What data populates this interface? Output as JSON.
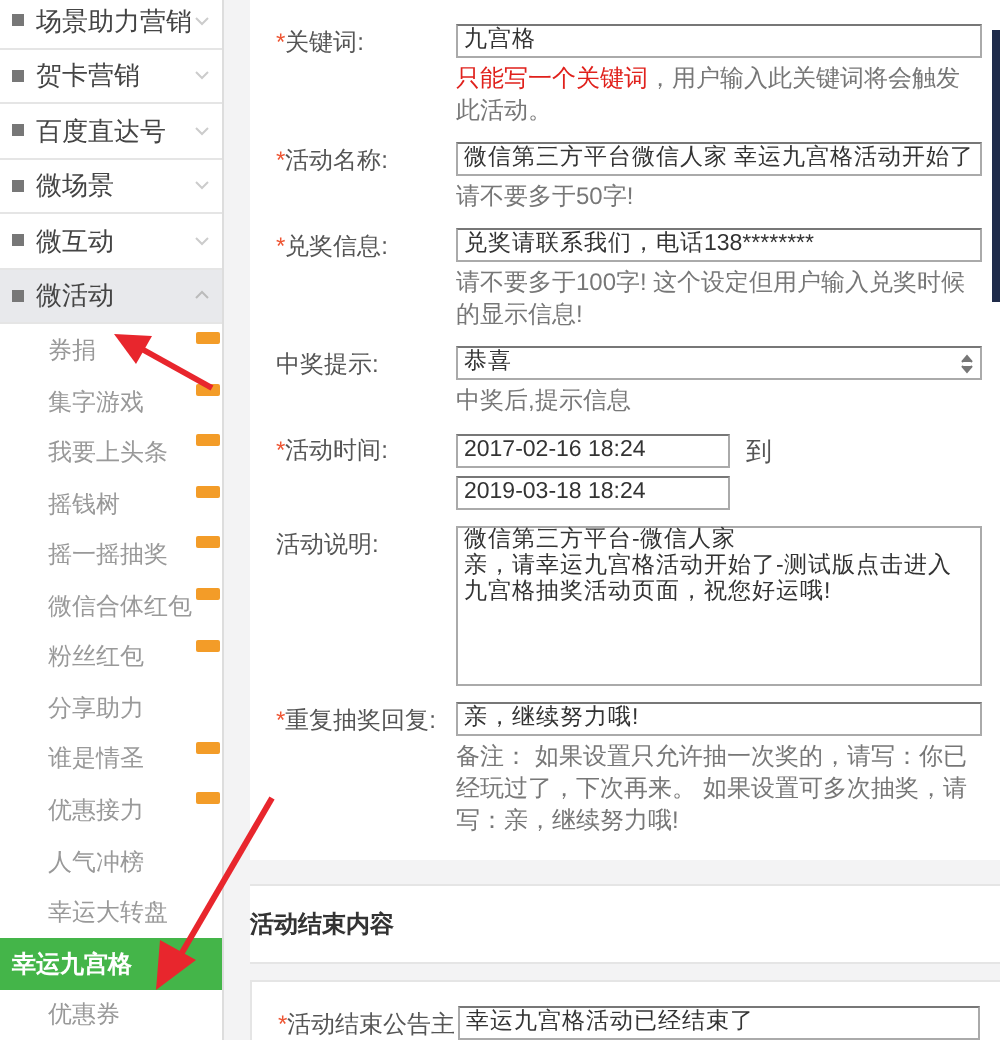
{
  "sidebar": {
    "menus": [
      {
        "label": "场景助力营销",
        "expanded": false
      },
      {
        "label": "贺卡营销",
        "expanded": false
      },
      {
        "label": "百度直达号",
        "expanded": false
      },
      {
        "label": "微场景",
        "expanded": false
      },
      {
        "label": "微互动",
        "expanded": false
      },
      {
        "label": "微活动",
        "expanded": true,
        "children": [
          {
            "label": "券捐",
            "badge": true,
            "selected": false
          },
          {
            "label": "集字游戏",
            "badge": true,
            "selected": false
          },
          {
            "label": "我要上头条",
            "badge": true,
            "selected": false
          },
          {
            "label": "摇钱树",
            "badge": true,
            "selected": false
          },
          {
            "label": "摇一摇抽奖",
            "badge": true,
            "selected": false
          },
          {
            "label": "微信合体红包",
            "badge": true,
            "selected": false
          },
          {
            "label": "粉丝红包",
            "badge": true,
            "selected": false
          },
          {
            "label": "分享助力",
            "badge": false,
            "selected": false
          },
          {
            "label": "谁是情圣",
            "badge": true,
            "selected": false
          },
          {
            "label": "优惠接力",
            "badge": true,
            "selected": false
          },
          {
            "label": "人气冲榜",
            "badge": false,
            "selected": false
          },
          {
            "label": "幸运大转盘",
            "badge": false,
            "selected": false
          },
          {
            "label": "幸运九宫格",
            "badge": false,
            "selected": true
          },
          {
            "label": "优惠券",
            "badge": false,
            "selected": false
          }
        ]
      }
    ]
  },
  "form": {
    "fields": [
      {
        "kind": "text",
        "label": "关键词:",
        "required_mark": "*",
        "value": "九宫格",
        "hint_warning": "只能写一个关键词",
        "hint": "，用户输入此关键词将会触发此活动。"
      },
      {
        "kind": "text",
        "label": "活动名称:",
        "required_mark": "*",
        "value": "微信第三方平台微信人家 幸运九宫格活动开始了",
        "hint": "请不要多于50字!"
      },
      {
        "kind": "text",
        "label": "兑奖信息:",
        "required_mark": "*",
        "value": "兑奖请联系我们，电话138********",
        "hint": "请不要多于100字! 这个设定但用户输入兑奖时候的显示信息!"
      },
      {
        "kind": "select",
        "label": "中奖提示:",
        "value": "恭喜",
        "hint": "中奖后,提示信息"
      },
      {
        "kind": "daterange",
        "label": "活动时间:",
        "required_mark": "*",
        "start": "2017-02-16 18:24",
        "separator": "到",
        "end": "2019-03-18 18:24"
      },
      {
        "kind": "textarea",
        "label": "活动说明:",
        "lines": [
          "微信第三方平台-微信人家",
          "亲，请幸运九宫格活动开始了-测试版点击进入",
          "九宫格抽奖活动页面，祝您好运哦!"
        ]
      },
      {
        "kind": "text",
        "label": "重复抽奖回复:",
        "required_mark": "*",
        "value": "亲，继续努力哦!",
        "hint": "备注： 如果设置只允许抽一次奖的，请写：你已经玩过了，下次再来。 如果设置可多次抽奖，请写：亲，继续努力哦!"
      }
    ]
  },
  "end_section": {
    "title": "活动结束内容",
    "fields": [
      {
        "kind": "text",
        "label": "活动结束公告主",
        "required_mark": "*",
        "value": "幸运九宫格活动已经结束了"
      }
    ]
  }
}
